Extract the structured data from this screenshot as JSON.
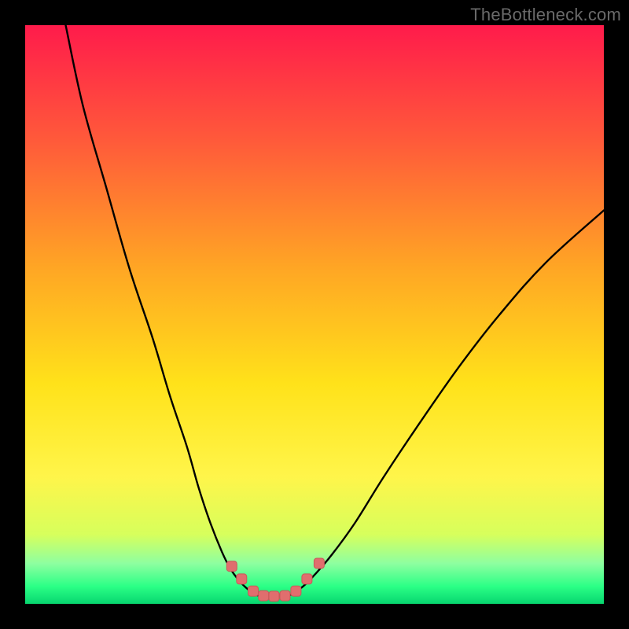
{
  "watermark": "TheBottleneck.com",
  "colors": {
    "frame": "#000000",
    "curve_stroke": "#000000",
    "marker_fill": "#e06e6e",
    "marker_stroke": "#c95959",
    "gradient_stops": [
      "#ff1b4b",
      "#ff5a3a",
      "#ffa624",
      "#ffe21a",
      "#fff54a",
      "#d7ff5c",
      "#8effa0",
      "#2bff86",
      "#07d66f"
    ]
  },
  "chart_data": {
    "type": "line",
    "title": "",
    "xlabel": "",
    "ylabel": "",
    "xlim": [
      0,
      100
    ],
    "ylim": [
      0,
      100
    ],
    "grid": false,
    "note": "V-shaped bottleneck style curve; y≈0 is green (good), y≈100 is red (bad). Values estimated from gradient height.",
    "series": [
      {
        "name": "left-branch",
        "x": [
          7,
          10,
          14,
          18,
          22,
          25,
          28,
          30,
          32,
          34,
          35.5,
          37,
          38.5,
          40
        ],
        "y": [
          100,
          86,
          72,
          58,
          46,
          36,
          27,
          20,
          14,
          9,
          6,
          4,
          2.5,
          1.5
        ]
      },
      {
        "name": "trough",
        "x": [
          40,
          42,
          44,
          46
        ],
        "y": [
          1.5,
          1.2,
          1.2,
          1.6
        ]
      },
      {
        "name": "right-branch",
        "x": [
          46,
          48,
          50,
          53,
          57,
          62,
          68,
          75,
          82,
          90,
          100
        ],
        "y": [
          1.6,
          3,
          5,
          8.5,
          14,
          22,
          31,
          41,
          50,
          59,
          68
        ]
      }
    ],
    "markers": {
      "name": "highlighted-points",
      "points": [
        {
          "x": 35.7,
          "y": 6.5
        },
        {
          "x": 37.4,
          "y": 4.3
        },
        {
          "x": 39.4,
          "y": 2.2
        },
        {
          "x": 41.2,
          "y": 1.4
        },
        {
          "x": 43.0,
          "y": 1.3
        },
        {
          "x": 44.9,
          "y": 1.4
        },
        {
          "x": 46.8,
          "y": 2.2
        },
        {
          "x": 48.7,
          "y": 4.3
        },
        {
          "x": 50.8,
          "y": 7.0
        }
      ]
    }
  }
}
